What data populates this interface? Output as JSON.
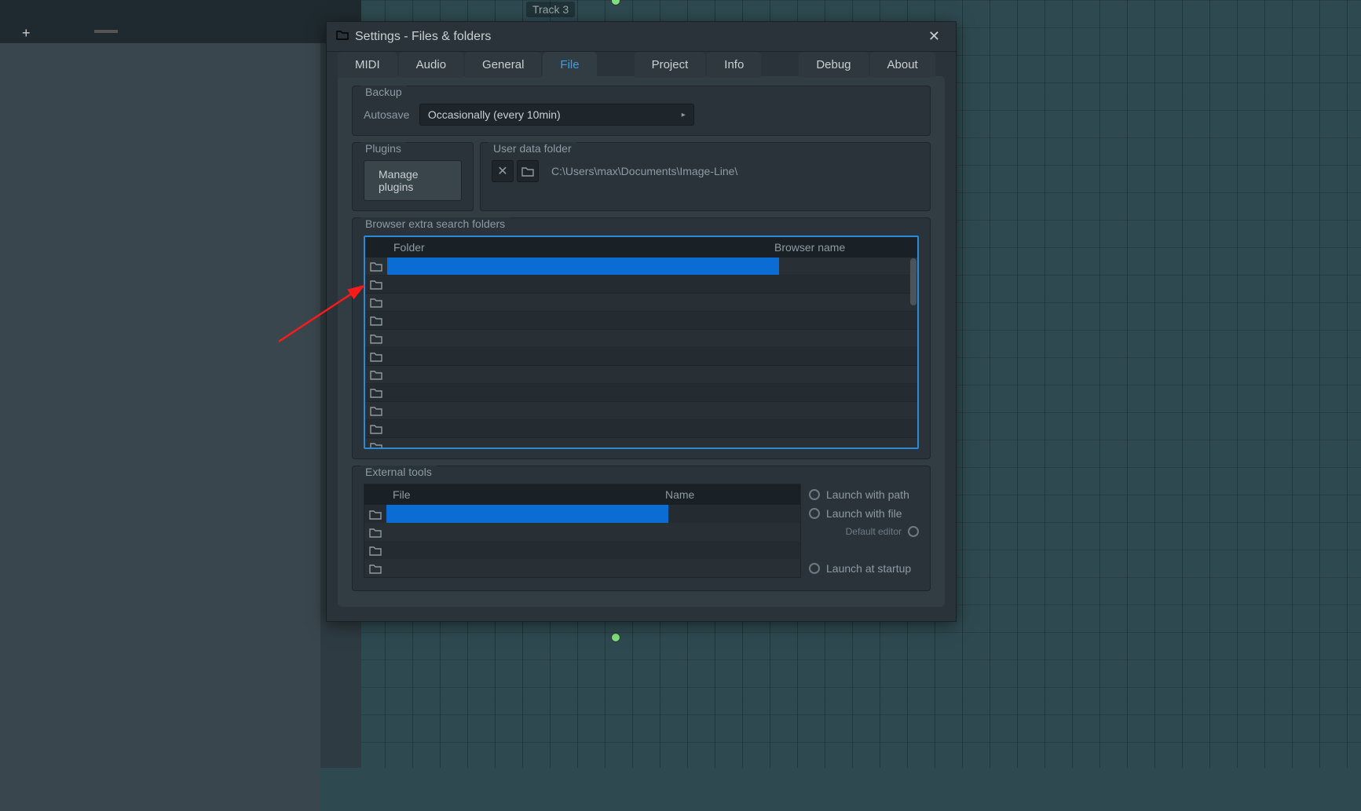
{
  "background": {
    "track_label": "Track 3"
  },
  "titlebar": {
    "title": "Settings - Files & folders"
  },
  "tabs": {
    "midi": "MIDI",
    "audio": "Audio",
    "general": "General",
    "file": "File",
    "project": "Project",
    "info": "Info",
    "debug": "Debug",
    "about": "About"
  },
  "backup": {
    "section": "Backup",
    "autosave_label": "Autosave",
    "autosave_value": "Occasionally (every 10min)"
  },
  "plugins": {
    "section": "Plugins",
    "manage_btn": "Manage plugins"
  },
  "userdata": {
    "section": "User data folder",
    "path": "C:\\Users\\max\\Documents\\Image-Line\\"
  },
  "browser_folders": {
    "section": "Browser extra search folders",
    "col_folder": "Folder",
    "col_name": "Browser name",
    "row_count": 11
  },
  "external_tools": {
    "section": "External tools",
    "col_file": "File",
    "col_name": "Name",
    "row_count": 4,
    "launch_path": "Launch with path",
    "launch_file": "Launch with file",
    "default_editor": "Default editor",
    "launch_startup": "Launch at startup"
  }
}
